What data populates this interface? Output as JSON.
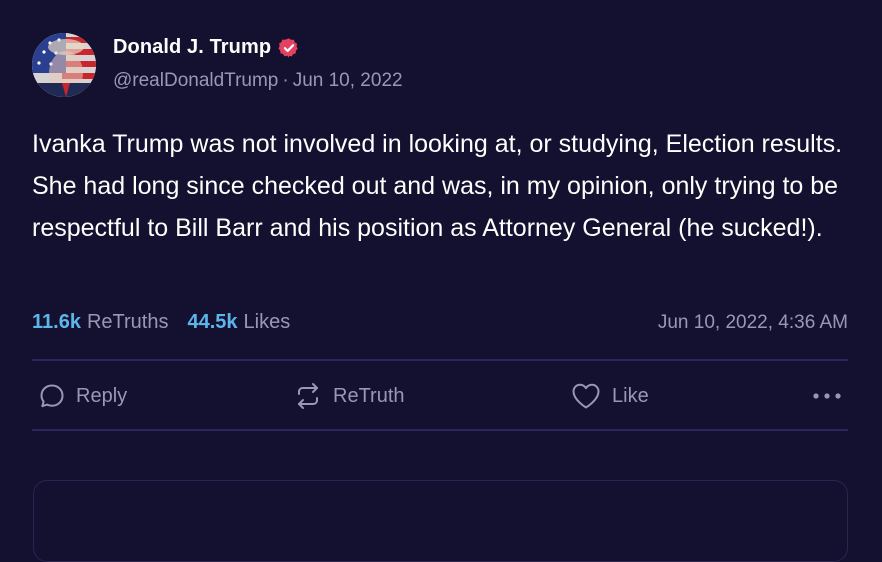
{
  "post": {
    "author": {
      "display_name": "Donald J. Trump",
      "handle": "@realDonaldTrump",
      "verified_icon": "verified-badge-icon",
      "avatar_icon": "avatar-photo"
    },
    "separator": "·",
    "date": "Jun 10, 2022",
    "body": "Ivanka Trump was not involved in looking at, or studying, Election results. She had long since checked out and was, in my opinion, only trying to be respectful to Bill Barr and his position as Attorney General (he sucked!).",
    "stats": {
      "retruths_count": "11.6k",
      "retruths_label": "ReTruths",
      "likes_count": "44.5k",
      "likes_label": "Likes"
    },
    "timestamp": "Jun 10, 2022, 4:36 AM"
  },
  "actions": {
    "reply_label": "Reply",
    "retruth_label": "ReTruth",
    "like_label": "Like",
    "more_icon": "more-dots-icon"
  },
  "colors": {
    "background": "#141130",
    "accent": "#5db6ea",
    "muted_text": "#9a97b3",
    "divider": "#2b2663",
    "verified": "#e4405f"
  }
}
